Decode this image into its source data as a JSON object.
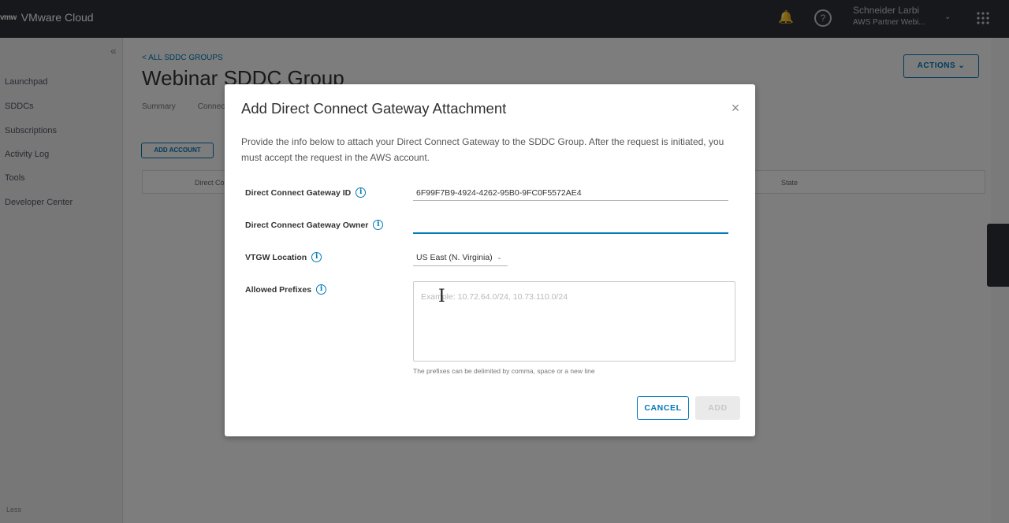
{
  "app": {
    "brand_logo": "vmw",
    "brand_name": "VMware Cloud",
    "user_name": "Schneider Larbi",
    "user_org": "AWS Partner Webi..."
  },
  "sidebar": {
    "items": [
      "Launchpad",
      "SDDCs",
      "Subscriptions",
      "Activity Log",
      "Tools",
      "Developer Center"
    ],
    "footer": "Less"
  },
  "page": {
    "breadcrumb": "< ALL SDDC GROUPS",
    "title": "Webinar SDDC Group",
    "actions_label": "ACTIONS",
    "tabs": [
      "Summary",
      "Connectivity"
    ],
    "add_account_label": "ADD ACCOUNT",
    "grid_columns": [
      "Direct Connect Gateway",
      "State"
    ]
  },
  "modal": {
    "title": "Add Direct Connect Gateway Attachment",
    "description": "Provide the info below to attach your Direct Connect Gateway to the SDDC Group. After the request is initiated, you must accept the request in the AWS account.",
    "fields": {
      "gateway_id": {
        "label": "Direct Connect Gateway ID",
        "value": "6F99F7B9-4924-4262-95B0-9FC0F5572AE4"
      },
      "gateway_owner": {
        "label": "Direct Connect Gateway Owner",
        "value": ""
      },
      "vtgw_location": {
        "label": "VTGW Location",
        "value": "US East (N. Virginia)"
      },
      "allowed_prefixes": {
        "label": "Allowed Prefixes",
        "placeholder": "Example: 10.72.64.0/24, 10.73.110.0/24",
        "helper": "The prefixes can be delimited by comma, space or a new line"
      }
    },
    "info_glyph": "i",
    "cancel_label": "CANCEL",
    "add_label": "ADD"
  }
}
